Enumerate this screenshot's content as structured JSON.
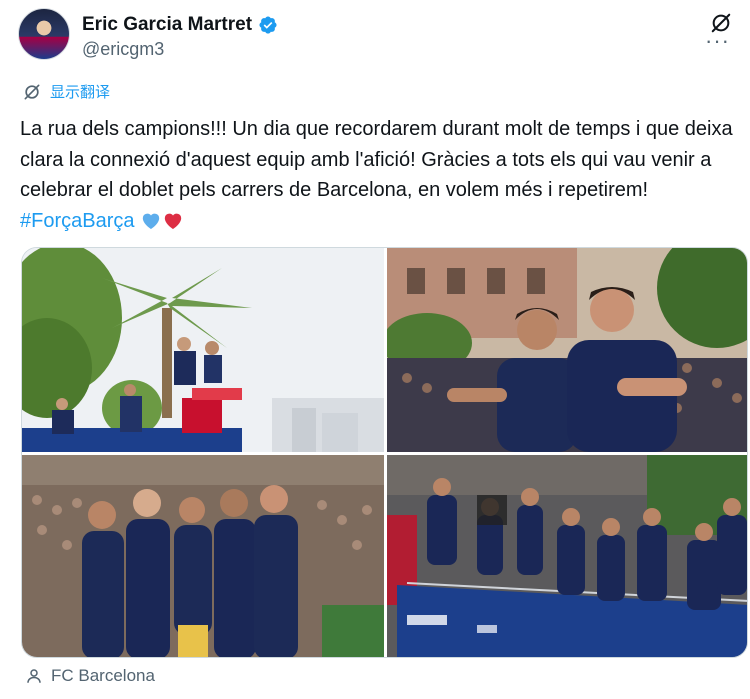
{
  "author": {
    "display_name": "Eric Garcia Martret",
    "handle": "@ericgm3",
    "verified": true
  },
  "icons": {
    "verified": "verified-badge-icon",
    "grok": "grok-icon",
    "more": "more-options-icon",
    "translate": "translate-icon",
    "tag": "person-tag-icon"
  },
  "translate_label": "显示翻译",
  "tweet": {
    "text": "La rua dels campions!!! Un dia que recordarem durant molt de temps i que deixa clara la connexió d'aquest equip amb l'afició! Gràcies a tots els qui vau venir a celebrar el doblet pels carrers de Barcelona, en volem més i repetirem! ",
    "hashtag": "#ForçaBarça",
    "emojis": [
      "blue-heart",
      "red-heart"
    ]
  },
  "media": {
    "count": 4,
    "photos": [
      {
        "name": "photo-bus-palm-tree",
        "description_icon": "photo"
      },
      {
        "name": "photo-two-players-smiling",
        "description_icon": "photo"
      },
      {
        "name": "photo-five-players-group",
        "description_icon": "photo"
      },
      {
        "name": "photo-team-bus-crowd",
        "description_icon": "photo"
      }
    ]
  },
  "tagged": {
    "label": "FC Barcelona"
  },
  "colors": {
    "accent": "#1d9bf0",
    "text": "#0f1419",
    "secondary_text": "#536471",
    "barca_blue": "#004d98",
    "barca_red": "#a50044"
  }
}
